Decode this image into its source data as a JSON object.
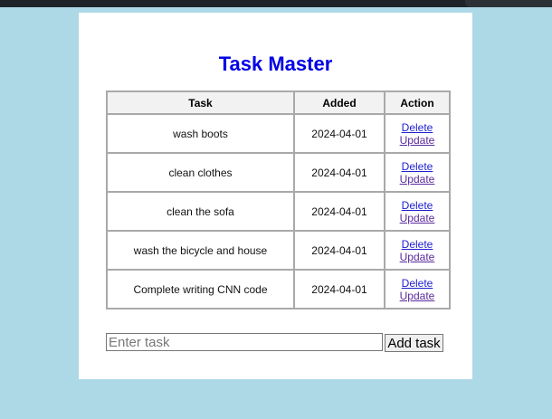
{
  "app": {
    "title": "Task Master"
  },
  "table": {
    "headers": [
      "Task",
      "Added",
      "Action"
    ],
    "rows": [
      {
        "task": "wash boots",
        "added": "2024-04-01",
        "delete": "Delete",
        "update": "Update"
      },
      {
        "task": "clean clothes",
        "added": "2024-04-01",
        "delete": "Delete",
        "update": "Update"
      },
      {
        "task": "clean the sofa",
        "added": "2024-04-01",
        "delete": "Delete",
        "update": "Update"
      },
      {
        "task": "wash the bicycle and house",
        "added": "2024-04-01",
        "delete": "Delete",
        "update": "Update"
      },
      {
        "task": "Complete writing CNN code",
        "added": "2024-04-01",
        "delete": "Delete",
        "update": "Update"
      }
    ]
  },
  "form": {
    "input_value": "",
    "input_placeholder": "Enter task",
    "submit_label": "Add task"
  },
  "colors": {
    "page_background": "#add8e6",
    "title_color": "#0000e6",
    "link_delete": "#2020d0",
    "link_update_visited": "#5a2a9a"
  }
}
